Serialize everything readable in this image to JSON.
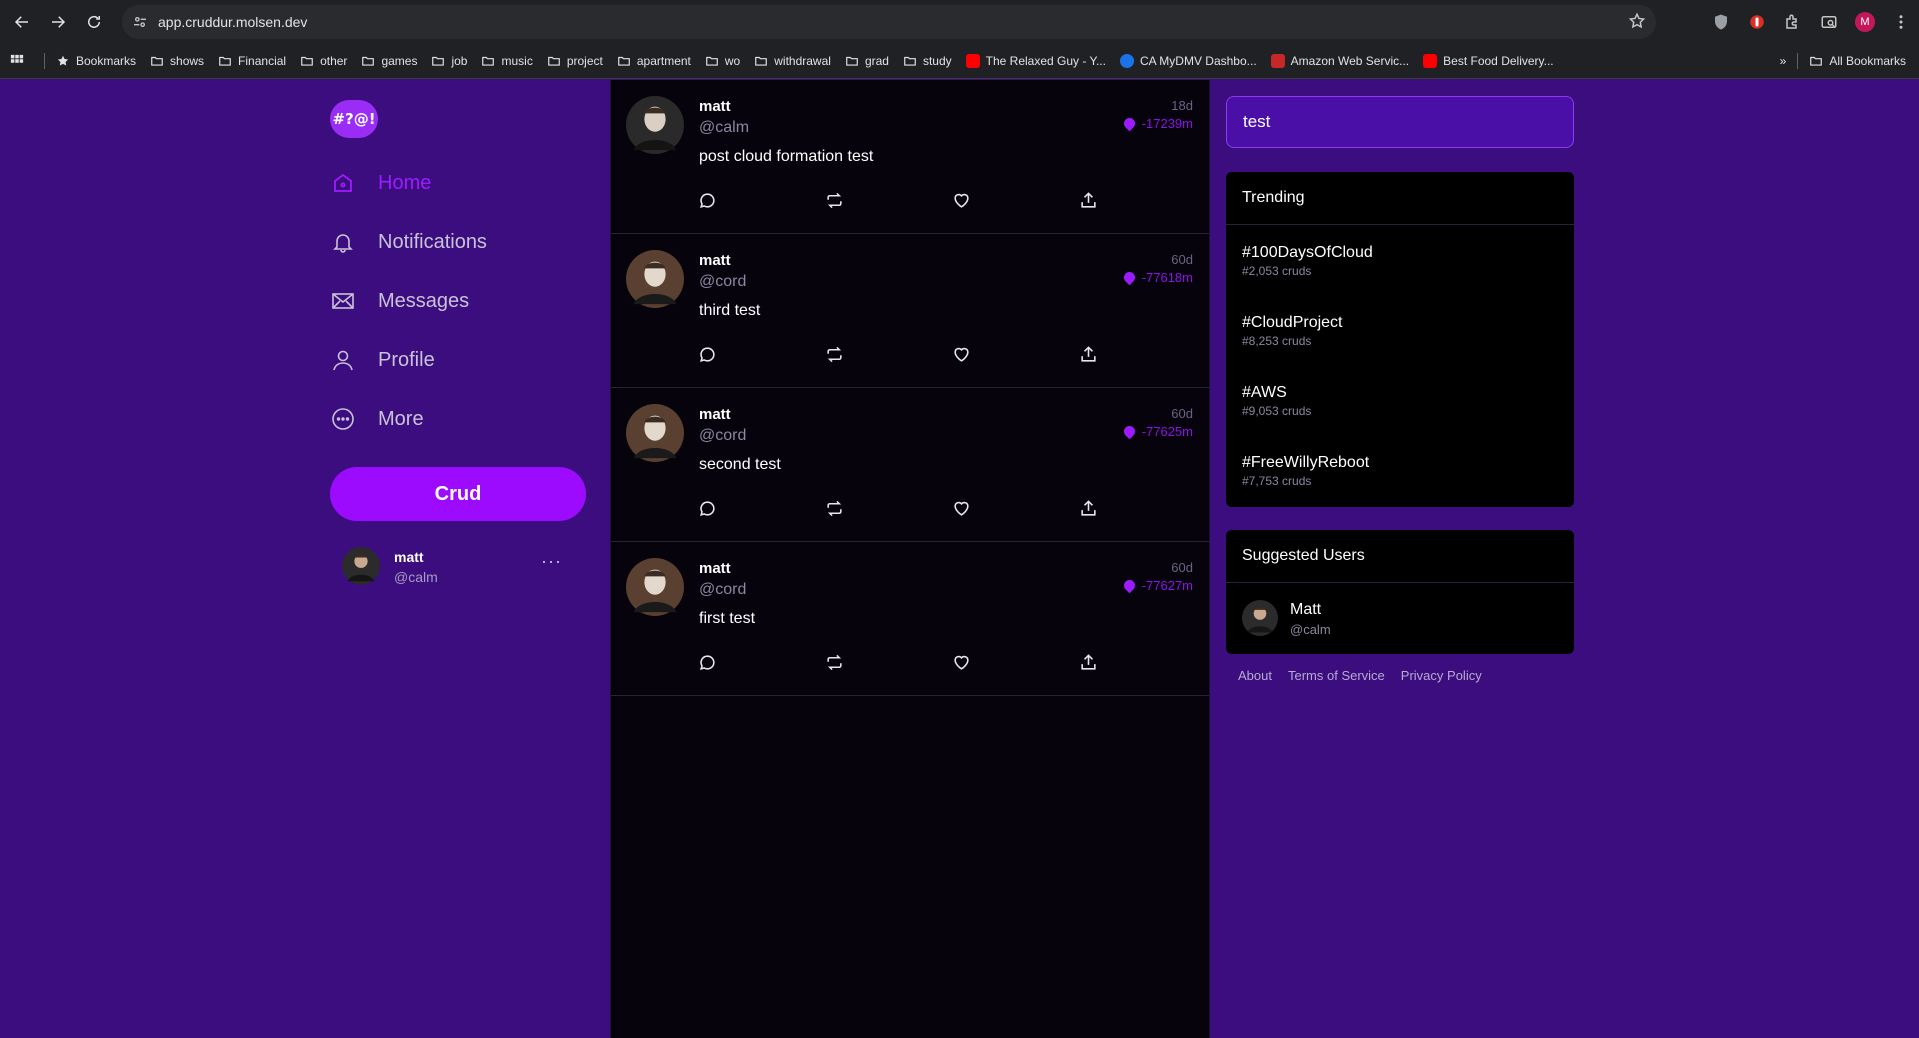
{
  "browser": {
    "url": "app.cruddur.molsen.dev",
    "profile_initial": "M",
    "bookmarks": [
      "Bookmarks",
      "shows",
      "Financial",
      "other",
      "games",
      "job",
      "music",
      "project",
      "apartment",
      "wo",
      "withdrawal",
      "grad",
      "study",
      "The Relaxed Guy - Y...",
      "CA MyDMV Dashbo...",
      "Amazon Web Servic...",
      "Best Food Delivery..."
    ],
    "all_bookmarks": "All Bookmarks",
    "overflow": "»"
  },
  "app": {
    "logo": "#?@!",
    "nav": [
      {
        "label": "Home",
        "icon": "home-icon"
      },
      {
        "label": "Notifications",
        "icon": "bell-icon"
      },
      {
        "label": "Messages",
        "icon": "envelope-icon"
      },
      {
        "label": "Profile",
        "icon": "person-icon"
      },
      {
        "label": "More",
        "icon": "more-circle-icon"
      }
    ],
    "crud_button": "Crud",
    "current_user": {
      "name": "matt",
      "handle": "@calm",
      "menu": "···"
    },
    "posts": [
      {
        "name": "matt",
        "handle": "@calm",
        "text": "post cloud formation test",
        "age": "18d",
        "expires": "-17239m"
      },
      {
        "name": "matt",
        "handle": "@cord",
        "text": "third test",
        "age": "60d",
        "expires": "-77618m"
      },
      {
        "name": "matt",
        "handle": "@cord",
        "text": "second test",
        "age": "60d",
        "expires": "-77625m"
      },
      {
        "name": "matt",
        "handle": "@cord",
        "text": "first test",
        "age": "60d",
        "expires": "-77627m"
      }
    ],
    "search": {
      "value": "test"
    },
    "trending": {
      "title": "Trending",
      "items": [
        {
          "tag": "#100DaysOfCloud",
          "count": "#2,053 cruds"
        },
        {
          "tag": "#CloudProject",
          "count": "#8,253 cruds"
        },
        {
          "tag": "#AWS",
          "count": "#9,053 cruds"
        },
        {
          "tag": "#FreeWillyReboot",
          "count": "#7,753 cruds"
        }
      ]
    },
    "suggested": {
      "title": "Suggested Users",
      "users": [
        {
          "name": "Matt",
          "handle": "@calm"
        }
      ]
    },
    "footer": [
      "About",
      "Terms of Service",
      "Privacy Policy"
    ]
  },
  "colors": {
    "accent": "#9d0bff",
    "sidebar_bg": "#3b0d7e",
    "feed_bg": "#07030d"
  }
}
